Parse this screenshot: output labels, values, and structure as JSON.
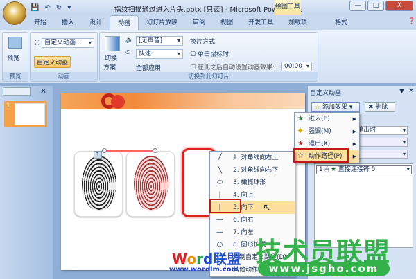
{
  "window": {
    "title": "指纹扫描通过进入片头.pptx [只读] - Microsoft PowerPoint",
    "context_tab": "绘图工具",
    "minimize": "—",
    "maximize": "□",
    "close": "X"
  },
  "qat": {
    "save": "💾",
    "undo": "↶",
    "redo": "↻",
    "more": "▾"
  },
  "tabs": [
    "开始",
    "插入",
    "设计",
    "动画",
    "幻灯片放映",
    "审阅",
    "视图",
    "开发工具",
    "加载项",
    "格式"
  ],
  "ribbon": {
    "preview": {
      "button": "预览",
      "label": "预览"
    },
    "animation": {
      "combo": "自定义动画...",
      "custom_button": "自定义动画",
      "label": "动画"
    },
    "transition": {
      "scheme": "切换",
      "scheme2": "方案",
      "sound": "[无声音]",
      "speed": "快速",
      "apply_all": "全部应用",
      "advance_title": "换片方式",
      "on_click": "单击鼠标时",
      "auto_after": "在此之后自动设置动画效果:",
      "time": "00:00",
      "label": "切换到此幻灯片"
    }
  },
  "slide_panel": {
    "slide_number": "1"
  },
  "slide": {
    "anim_tag": "1"
  },
  "custom_anim_pane": {
    "title": "自定义动画",
    "add_effect": "添加效果",
    "delete": "删除",
    "start_value": "单击时",
    "item_index": "1",
    "item_name": "直接连接符 5"
  },
  "add_effect_menu": [
    {
      "label": "进入(E)",
      "icon": "★",
      "color": "#1f7a3a"
    },
    {
      "label": "强调(M)",
      "icon": "✸",
      "color": "#d8b000"
    },
    {
      "label": "退出(X)",
      "icon": "★",
      "color": "#c0282a"
    },
    {
      "label": "动作路径(P)",
      "icon": "☆",
      "color": "#555555"
    }
  ],
  "path_menu": [
    {
      "label": "1. 对角线向右上",
      "icon": "╱"
    },
    {
      "label": "2. 对角线向右下",
      "icon": "╲"
    },
    {
      "label": "3. 橄榄球形",
      "icon": "⬭"
    },
    {
      "label": "4. 向上",
      "icon": "|"
    },
    {
      "label": "5. 向下",
      "icon": "|"
    },
    {
      "label": "6. 向右",
      "icon": "—"
    },
    {
      "label": "7. 向左",
      "icon": "—"
    },
    {
      "label": "8. 圆形扩展",
      "icon": "○"
    },
    {
      "label": "绘制自定义路径(D)",
      "icon": ""
    },
    {
      "label": "其他动作路径(M)...",
      "icon": ""
    }
  ],
  "watermarks": {
    "jsgho_title": "技术员联盟",
    "jsgho_url": "www.jsgho.com",
    "wordlm_title": "Word联盟",
    "wordlm_url": "www.wordlm.com"
  }
}
